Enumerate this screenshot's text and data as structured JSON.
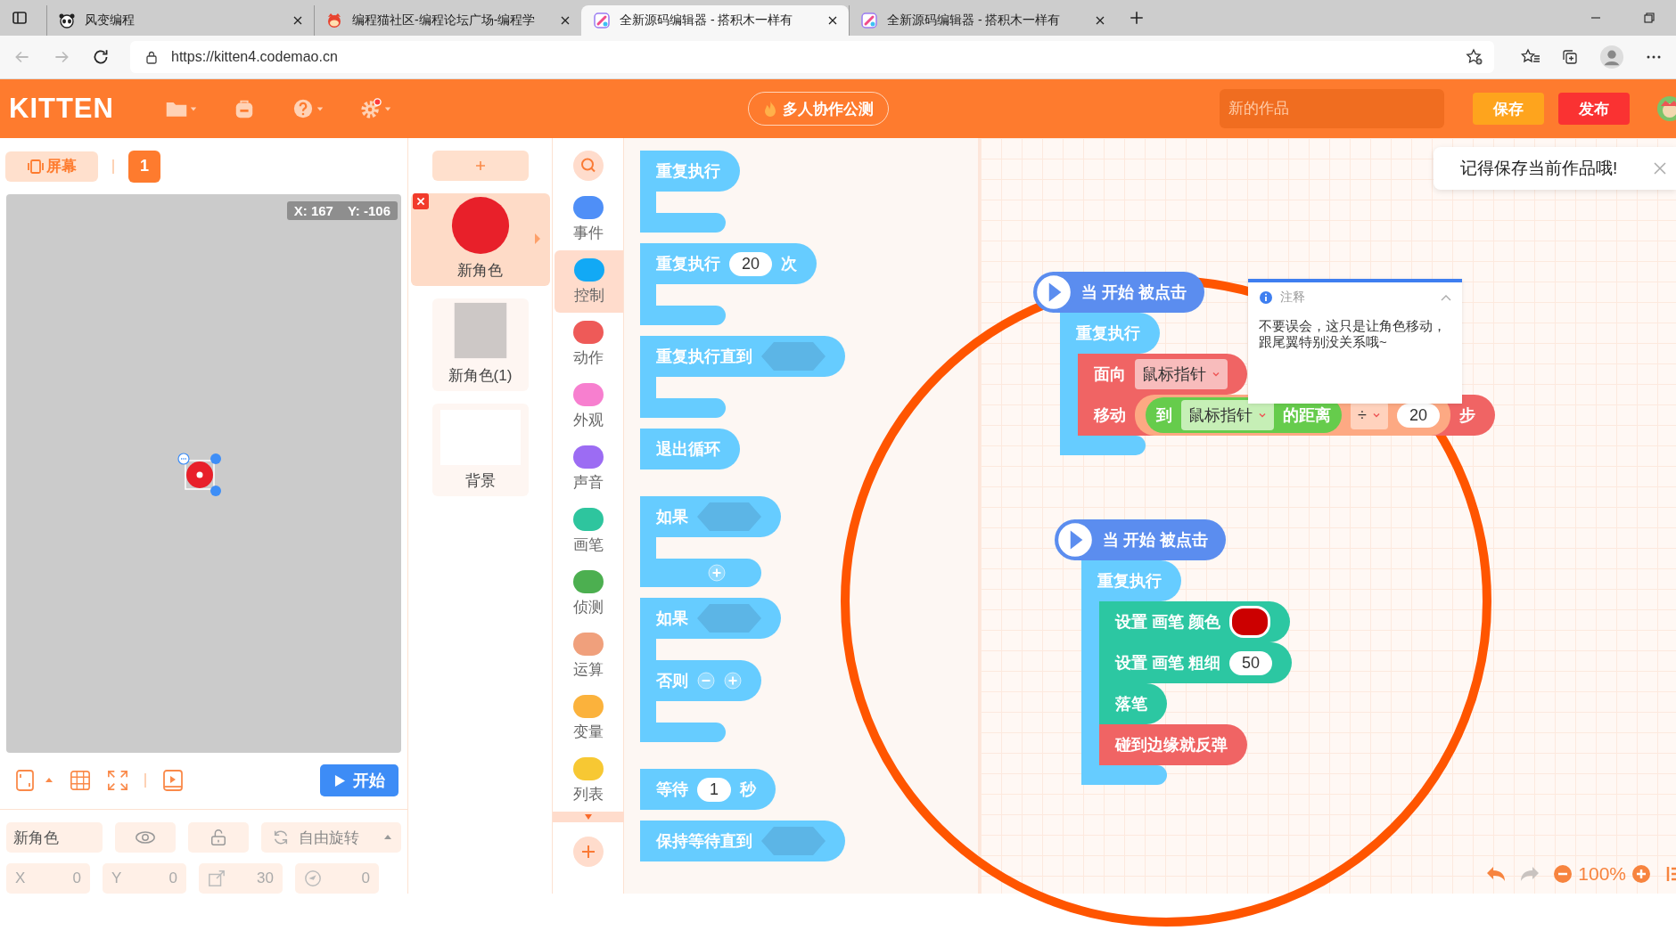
{
  "browser": {
    "tabs": [
      {
        "title": "风变编程",
        "selected": false
      },
      {
        "title": "编程猫社区-编程论坛广场-编程学",
        "selected": false
      },
      {
        "title": "全新源码编辑器 - 搭积木一样有",
        "selected": true
      },
      {
        "title": "全新源码编辑器 - 搭积木一样有",
        "selected": false
      }
    ],
    "url": "https://kitten4.codemao.cn"
  },
  "header": {
    "logo": "KITTEN",
    "collab_button": "多人协作公测",
    "title_field": {
      "placeholder": "新的作品"
    },
    "save_button": "保存",
    "publish_button": "发布"
  },
  "stage": {
    "screen_button": "屏幕",
    "page_number": "1",
    "x_reading": "X: 167",
    "y_reading": "Y: -106",
    "start_button": "开始"
  },
  "sprite_props": {
    "name": "新角色",
    "rotation": "自由旋转",
    "fields": [
      {
        "kind": "x",
        "label": "X",
        "value": "0"
      },
      {
        "kind": "y",
        "label": "Y",
        "value": "0"
      },
      {
        "kind": "size",
        "value": "30"
      },
      {
        "kind": "direction",
        "value": "0"
      }
    ]
  },
  "sprites": [
    {
      "name": "新角色",
      "kind": "circle",
      "selected": true
    },
    {
      "name": "新角色(1)",
      "kind": "square",
      "selected": false
    },
    {
      "name": "背景",
      "kind": "blank",
      "selected": false
    }
  ],
  "categories": [
    {
      "label": "事件",
      "color": "#4f8ff7",
      "selected": false
    },
    {
      "label": "控制",
      "color": "#12a9f5",
      "selected": true
    },
    {
      "label": "动作",
      "color": "#ee5a58",
      "selected": false
    },
    {
      "label": "外观",
      "color": "#f77fcf",
      "selected": false
    },
    {
      "label": "声音",
      "color": "#9c6cf3",
      "selected": false
    },
    {
      "label": "画笔",
      "color": "#2ec59e",
      "selected": false
    },
    {
      "label": "侦测",
      "color": "#4caf50",
      "selected": false
    },
    {
      "label": "运算",
      "color": "#f0a07c",
      "selected": false
    },
    {
      "label": "变量",
      "color": "#fbb23c",
      "selected": false
    },
    {
      "label": "列表",
      "color": "#f7c833",
      "selected": false
    }
  ],
  "palette_sections": [
    {
      "blocks": [
        {
          "kind": "loop",
          "parts": [
            {
              "kind": "text",
              "text": "重复执行"
            }
          ]
        },
        {
          "kind": "loop",
          "parts": [
            {
              "kind": "text",
              "text": "重复执行"
            },
            {
              "kind": "number",
              "text": "20"
            },
            {
              "kind": "text",
              "text": "次"
            }
          ]
        },
        {
          "kind": "loop",
          "parts": [
            {
              "kind": "text",
              "text": "重复执行直到"
            },
            {
              "kind": "hex"
            }
          ]
        },
        {
          "kind": "stack",
          "parts": [
            {
              "kind": "text",
              "text": "退出循环"
            }
          ]
        }
      ]
    },
    {
      "blocks": [
        {
          "kind": "if",
          "parts": [
            {
              "kind": "text",
              "text": "如果"
            },
            {
              "kind": "hex"
            }
          ],
          "foot_parts": [
            {
              "kind": "add"
            }
          ]
        },
        {
          "kind": "if_else",
          "parts": [
            {
              "kind": "text",
              "text": "如果"
            },
            {
              "kind": "hex"
            }
          ],
          "else_parts": [
            {
              "kind": "text",
              "text": "否则"
            },
            {
              "kind": "remove"
            },
            {
              "kind": "add"
            }
          ]
        }
      ]
    },
    {
      "blocks": [
        {
          "kind": "stack",
          "parts": [
            {
              "kind": "text",
              "text": "等待"
            },
            {
              "kind": "number",
              "text": "1"
            },
            {
              "kind": "text",
              "text": "秒"
            }
          ]
        },
        {
          "kind": "stack",
          "parts": [
            {
              "kind": "text",
              "text": "保持等待直到"
            },
            {
              "kind": "hex"
            }
          ]
        }
      ]
    }
  ],
  "toast": {
    "text": "记得保存当前作品哦!"
  },
  "comment": {
    "title": "注释",
    "text": "不要误会，这只是让角色移动，跟尾翼特别没关系哦~"
  },
  "scripts": [
    {
      "hat": "当 开始 被点击",
      "loop_label": "重复执行",
      "blocks": [
        {
          "kind": "motion",
          "parts": [
            {
              "kind": "text",
              "text": "面向"
            },
            {
              "kind": "dropdown",
              "text": "鼠标指针"
            }
          ]
        },
        {
          "kind": "motion",
          "parts": [
            {
              "kind": "text",
              "text": "移动"
            },
            {
              "kind": "operator",
              "parts": [
                {
                  "kind": "sensing",
                  "parts": [
                    {
                      "kind": "text",
                      "text": "到"
                    },
                    {
                      "kind": "dropdown",
                      "text": "鼠标指针"
                    },
                    {
                      "kind": "text",
                      "text": "的距离"
                    }
                  ]
                },
                {
                  "kind": "dropdown",
                  "text": "÷"
                },
                {
                  "kind": "number",
                  "text": "20"
                }
              ]
            },
            {
              "kind": "text",
              "text": "步"
            }
          ]
        }
      ]
    },
    {
      "hat": "当 开始 被点击",
      "loop_label": "重复执行",
      "blocks": [
        {
          "kind": "pen",
          "parts": [
            {
              "kind": "text",
              "text": "设置 画笔 颜色"
            },
            {
              "kind": "color",
              "color": "#cc0000"
            }
          ]
        },
        {
          "kind": "pen",
          "parts": [
            {
              "kind": "text",
              "text": "设置 画笔 粗细"
            },
            {
              "kind": "number",
              "text": "50"
            }
          ]
        },
        {
          "kind": "pen",
          "parts": [
            {
              "kind": "text",
              "text": "落笔"
            }
          ]
        },
        {
          "kind": "motion",
          "parts": [
            {
              "kind": "text",
              "text": "碰到边缘就反弹"
            }
          ]
        }
      ]
    }
  ],
  "zoom": {
    "level_text": "100%"
  }
}
